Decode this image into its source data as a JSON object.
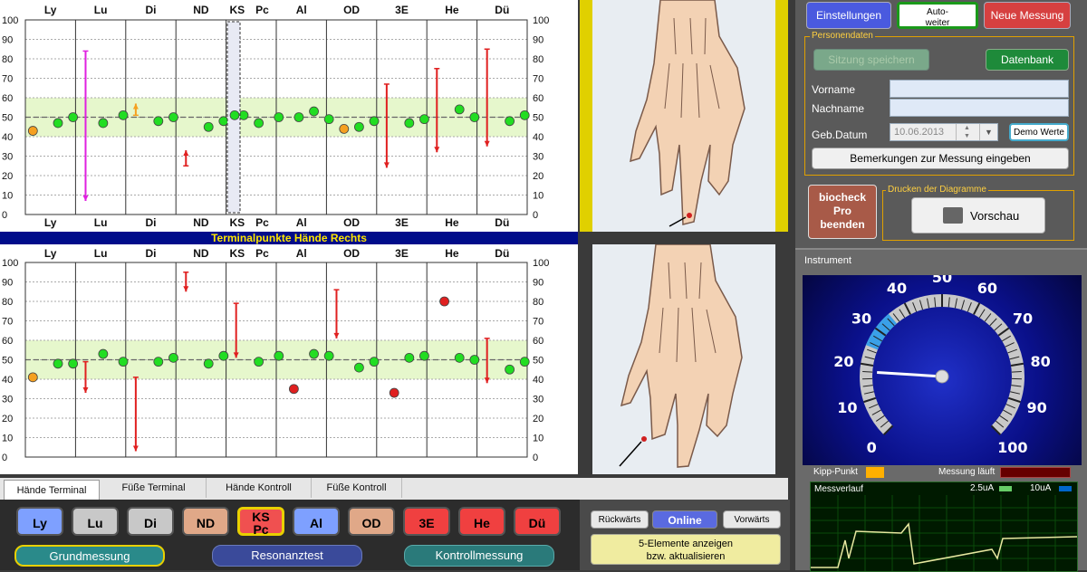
{
  "columns": [
    "Ly",
    "Lu",
    "Di",
    "ND",
    "KS",
    "Pc",
    "Al",
    "OD",
    "3E",
    "He",
    "Dü"
  ],
  "y_ticks": [
    "100",
    "90",
    "80",
    "70",
    "60",
    "50",
    "40",
    "30",
    "20",
    "10",
    "0"
  ],
  "chart_top": {
    "title": "",
    "chart_data": {
      "type": "scatter",
      "ylim": [
        0,
        100
      ],
      "band": [
        40,
        60
      ],
      "dashed_line": 50,
      "points": [
        {
          "x": 0,
          "y": 43,
          "c": "#f5a020"
        },
        {
          "x": 0.5,
          "y": 47,
          "c": "#22dd22"
        },
        {
          "x": 0.8,
          "y": 50,
          "c": "#22dd22"
        },
        {
          "x": 1.4,
          "y": 47,
          "c": "#22dd22"
        },
        {
          "x": 1.8,
          "y": 51,
          "c": "#22dd22"
        },
        {
          "x": 2.5,
          "y": 48,
          "c": "#22dd22"
        },
        {
          "x": 2.8,
          "y": 50,
          "c": "#22dd22"
        },
        {
          "x": 3.5,
          "y": 45,
          "c": "#22dd22"
        },
        {
          "x": 3.8,
          "y": 48,
          "c": "#22dd22"
        },
        {
          "x": 4.2,
          "y": 51,
          "c": "#22dd22"
        },
        {
          "x": 4.5,
          "y": 47,
          "c": "#22dd22"
        },
        {
          "x": 4.9,
          "y": 50,
          "c": "#22dd22"
        },
        {
          "x": 5.3,
          "y": 50,
          "c": "#22dd22"
        },
        {
          "x": 5.6,
          "y": 53,
          "c": "#22dd22"
        },
        {
          "x": 5.9,
          "y": 49,
          "c": "#22dd22"
        },
        {
          "x": 6.2,
          "y": 44,
          "c": "#f5a020"
        },
        {
          "x": 6.5,
          "y": 45,
          "c": "#22dd22"
        },
        {
          "x": 6.8,
          "y": 48,
          "c": "#22dd22"
        },
        {
          "x": 7.5,
          "y": 47,
          "c": "#22dd22"
        },
        {
          "x": 7.8,
          "y": 49,
          "c": "#22dd22"
        },
        {
          "x": 8.5,
          "y": 54,
          "c": "#22dd22"
        },
        {
          "x": 8.8,
          "y": 50,
          "c": "#22dd22"
        },
        {
          "x": 9.5,
          "y": 48,
          "c": "#22dd22"
        },
        {
          "x": 9.8,
          "y": 51,
          "c": "#22dd22"
        }
      ],
      "arrows": [
        {
          "x": 1.2,
          "from": 84,
          "to": 7,
          "c": "#e020e0"
        },
        {
          "x": 2.2,
          "from": 51,
          "to": 57,
          "c": "#f5a020"
        },
        {
          "x": 3.2,
          "from": 25,
          "to": 33,
          "c": "#e02020"
        },
        {
          "x": 7.2,
          "from": 67,
          "to": 24,
          "c": "#e02020"
        },
        {
          "x": 8.2,
          "from": 75,
          "to": 32,
          "c": "#e02020"
        },
        {
          "x": 9.2,
          "from": 85,
          "to": 35,
          "c": "#e02020"
        }
      ]
    }
  },
  "chart_bottom": {
    "title": "Terminalpunkte Hände Rechts",
    "chart_data": {
      "type": "scatter",
      "ylim": [
        0,
        100
      ],
      "band": [
        40,
        60
      ],
      "dashed_line": 50,
      "points": [
        {
          "x": 0,
          "y": 41,
          "c": "#f5a020"
        },
        {
          "x": 0.5,
          "y": 48,
          "c": "#22dd22"
        },
        {
          "x": 0.8,
          "y": 48,
          "c": "#22dd22"
        },
        {
          "x": 1.4,
          "y": 53,
          "c": "#22dd22"
        },
        {
          "x": 1.8,
          "y": 49,
          "c": "#22dd22"
        },
        {
          "x": 2.5,
          "y": 49,
          "c": "#22dd22"
        },
        {
          "x": 2.8,
          "y": 51,
          "c": "#22dd22"
        },
        {
          "x": 3.5,
          "y": 48,
          "c": "#22dd22"
        },
        {
          "x": 3.8,
          "y": 52,
          "c": "#22dd22"
        },
        {
          "x": 4.5,
          "y": 49,
          "c": "#22dd22"
        },
        {
          "x": 4.9,
          "y": 52,
          "c": "#22dd22"
        },
        {
          "x": 5.2,
          "y": 35,
          "c": "#e02020"
        },
        {
          "x": 5.6,
          "y": 53,
          "c": "#22dd22"
        },
        {
          "x": 5.9,
          "y": 52,
          "c": "#22dd22"
        },
        {
          "x": 6.5,
          "y": 46,
          "c": "#22dd22"
        },
        {
          "x": 6.8,
          "y": 49,
          "c": "#22dd22"
        },
        {
          "x": 7.2,
          "y": 33,
          "c": "#e02020"
        },
        {
          "x": 7.5,
          "y": 51,
          "c": "#22dd22"
        },
        {
          "x": 7.8,
          "y": 52,
          "c": "#22dd22"
        },
        {
          "x": 8.2,
          "y": 80,
          "c": "#e02020"
        },
        {
          "x": 8.5,
          "y": 51,
          "c": "#22dd22"
        },
        {
          "x": 8.8,
          "y": 50,
          "c": "#22dd22"
        },
        {
          "x": 9.5,
          "y": 45,
          "c": "#22dd22"
        },
        {
          "x": 9.8,
          "y": 49,
          "c": "#22dd22"
        }
      ],
      "arrows": [
        {
          "x": 1.2,
          "from": 49,
          "to": 33,
          "c": "#e02020"
        },
        {
          "x": 2.2,
          "from": 41,
          "to": 3,
          "c": "#e02020"
        },
        {
          "x": 3.2,
          "from": 95,
          "to": 85,
          "c": "#e02020"
        },
        {
          "x": 4.2,
          "from": 79,
          "to": 51,
          "c": "#e02020"
        },
        {
          "x": 6.2,
          "from": 86,
          "to": 61,
          "c": "#e02020"
        },
        {
          "x": 9.2,
          "from": 61,
          "to": 38,
          "c": "#e02020"
        }
      ]
    }
  },
  "tabs": [
    "Hände Terminal",
    "Füße Terminal",
    "Hände Kontroll",
    "Füße Kontroll"
  ],
  "meridian_buttons": [
    {
      "label": "Ly",
      "color": "#7ea0ff"
    },
    {
      "label": "Lu",
      "color": "#c8c8c8"
    },
    {
      "label": "Di",
      "color": "#c8c8c8"
    },
    {
      "label": "ND",
      "color": "#e0a888"
    },
    {
      "label": "KS\nPc",
      "color": "#f05050"
    },
    {
      "label": "Al",
      "color": "#7ea0ff"
    },
    {
      "label": "OD",
      "color": "#e0a888"
    },
    {
      "label": "3E",
      "color": "#f04040"
    },
    {
      "label": "He",
      "color": "#f04040"
    },
    {
      "label": "Dü",
      "color": "#f04040"
    }
  ],
  "mode_buttons": [
    "Grundmessung",
    "Resonanztest",
    "Kontrollmessung"
  ],
  "nav": {
    "back": "Rückwärts",
    "online": "Online",
    "forward": "Vorwärts"
  },
  "elements_btn": "5-Elemente anzeigen\nbzw. aktualisieren",
  "top_buttons": {
    "settings": "Einstellungen",
    "auto": "Auto-\nweiter",
    "new": "Neue Messung"
  },
  "personendaten": {
    "legend": "Personendaten",
    "save": "Sitzung speichern",
    "db": "Datenbank",
    "vorname_label": "Vorname",
    "nachname_label": "Nachname",
    "geb_label": "Geb.Datum",
    "geb_value": "10.06.2013",
    "demo": "Demo Werte",
    "remarks": "Bemerkungen zur Messung eingeben"
  },
  "quit_btn": "biocheck\nPro\nbeenden",
  "print": {
    "legend": "Drucken der Diagramme",
    "preview": "Vorschau"
  },
  "instrument": {
    "title": "Instrument",
    "value": 18,
    "highlight": [
      25,
      35
    ],
    "labels": [
      "0",
      "10",
      "20",
      "30",
      "40",
      "50",
      "60",
      "70",
      "80",
      "90",
      "100"
    ],
    "kipp": "Kipp-Punkt",
    "messung": "Messung läuft",
    "verlauf": "Messverlauf",
    "scale1": "2.5uA",
    "scale2": "10uA"
  }
}
